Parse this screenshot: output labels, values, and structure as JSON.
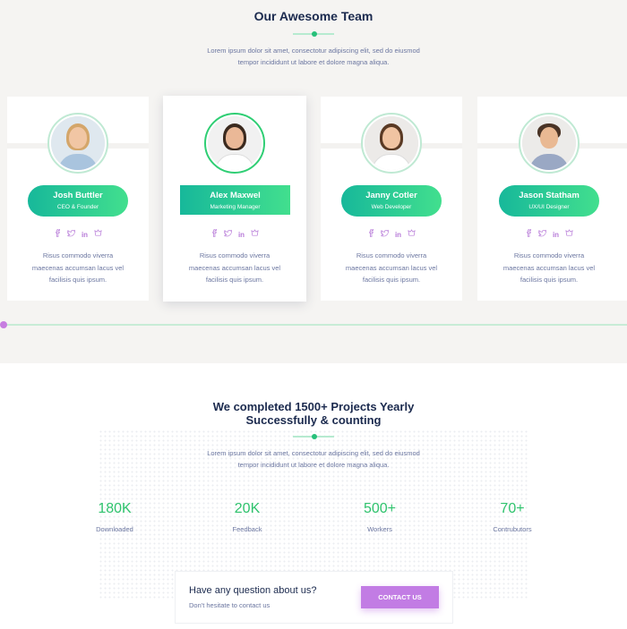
{
  "team": {
    "title": "Our Awesome Team",
    "description_line1": "Lorem ipsum dolor sit amet, consectotur adipiscing elit, sed do eiusmod",
    "description_line2": "tempor incididunt ut labore et dolore magna aliqua.",
    "members": [
      {
        "name": "Josh Buttler",
        "role": "CEO & Founder",
        "text_line1": "Risus commodo viverra",
        "text_line2": "maecenas accumsan lacus vel",
        "text_line3": "facilisis quis ipsum."
      },
      {
        "name": "Alex Maxwel",
        "role": "Marketing Manager",
        "text_line1": "Risus commodo viverra",
        "text_line2": "maecenas accumsan lacus vel",
        "text_line3": "facilisis quis ipsum."
      },
      {
        "name": "Janny Cotler",
        "role": "Web Developer",
        "text_line1": "Risus commodo viverra",
        "text_line2": "maecenas accumsan lacus vel",
        "text_line3": "facilisis quis ipsum."
      },
      {
        "name": "Jason Statham",
        "role": "UX/UI Designer",
        "text_line1": "Risus commodo viverra",
        "text_line2": "maecenas accumsan lacus vel",
        "text_line3": "facilisis quis ipsum."
      }
    ],
    "social_icons": [
      "facebook-icon",
      "twitter-icon",
      "linkedin-icon",
      "dribbble-icon"
    ],
    "slider_position_percent": 0
  },
  "projects": {
    "title_line1": "We completed 1500+ Projects Yearly",
    "title_line2": "Successfully & counting",
    "description_line1": "Lorem ipsum dolor sit amet, consectotur adipiscing elit, sed do eiusmod",
    "description_line2": "tempor incididunt ut labore et dolore magna aliqua.",
    "stats": [
      {
        "value": "180K",
        "label": "Downloaded"
      },
      {
        "value": "20K",
        "label": "Feedback"
      },
      {
        "value": "500+",
        "label": "Workers"
      },
      {
        "value": "70+",
        "label": "Contrubutors"
      }
    ]
  },
  "cta": {
    "question": "Have any question about us?",
    "subtext": "Don't hesitate to contact us",
    "button_label": "CONTACT US"
  },
  "colors": {
    "accent_green": "#2fc36d",
    "gradient_start": "#17b89a",
    "gradient_end": "#42df8e",
    "accent_purple": "#c27ce4",
    "heading": "#1b2a4e",
    "body_text": "#6b76a0"
  }
}
